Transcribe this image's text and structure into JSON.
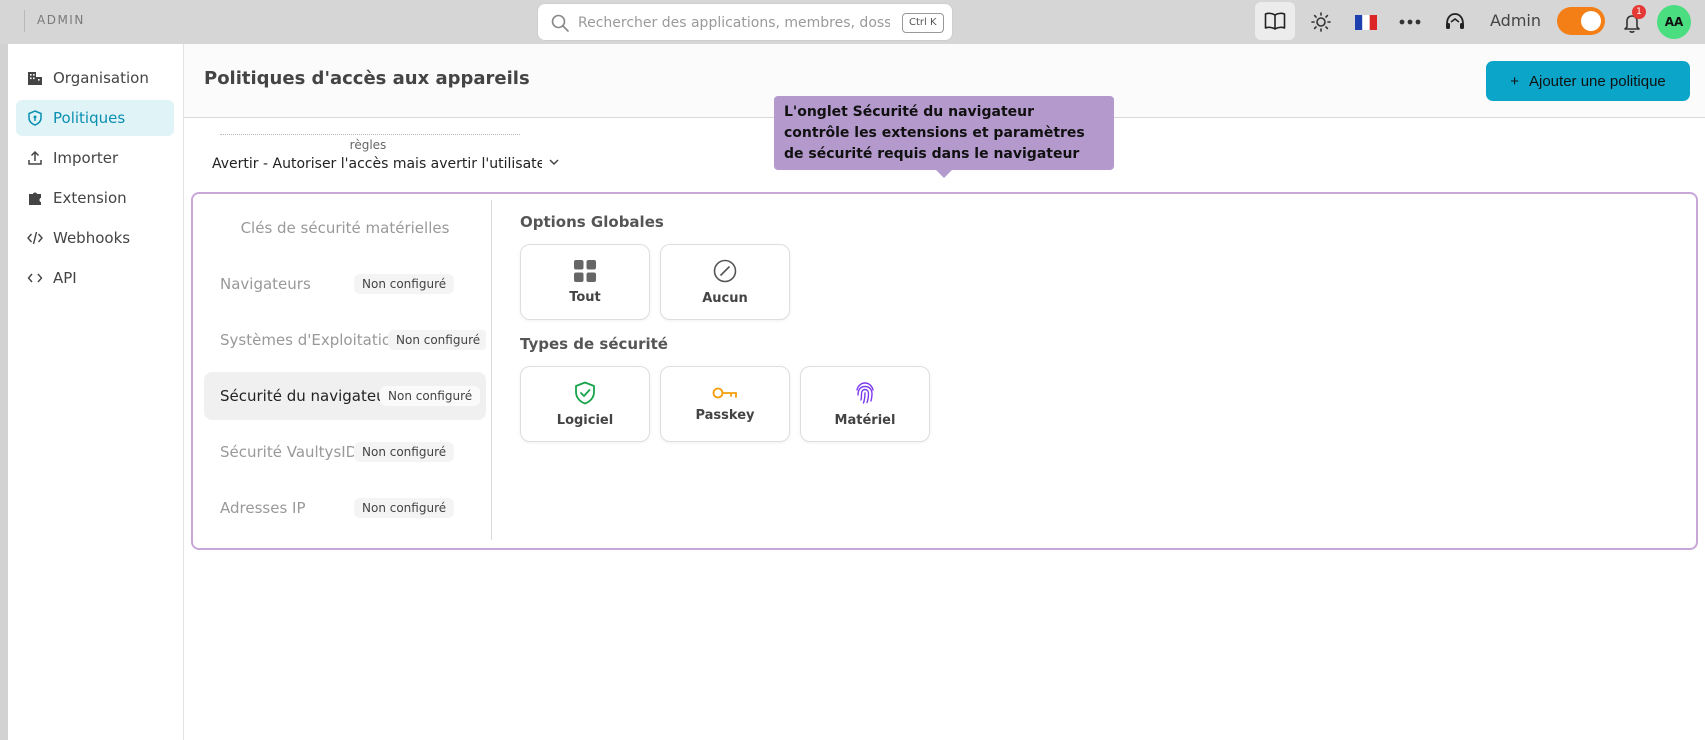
{
  "topbar": {
    "brand": "ADMIN",
    "search_placeholder": "Rechercher des applications, membres, dossiers",
    "search_shortcut": "Ctrl K",
    "user_label": "Admin",
    "notification_count": "1",
    "avatar_initials": "AA",
    "icons": [
      "book-icon",
      "sun-icon",
      "flag-fr-icon",
      "more-icon",
      "support-icon",
      "bell-icon"
    ]
  },
  "sidebar": {
    "items": [
      {
        "label": "Organisation",
        "icon": "building-icon",
        "active": false
      },
      {
        "label": "Politiques",
        "icon": "shield-icon",
        "active": true
      },
      {
        "label": "Importer",
        "icon": "upload-icon",
        "active": false
      },
      {
        "label": "Extension",
        "icon": "puzzle-icon",
        "active": false
      },
      {
        "label": "Webhooks",
        "icon": "code-slash-icon",
        "active": false
      },
      {
        "label": "API",
        "icon": "code-icon",
        "active": false
      }
    ]
  },
  "main": {
    "title": "Politiques d'accès aux appareils",
    "add_button": "Ajouter une politique",
    "rule_select": {
      "label": "règles",
      "value": "Avertir - Autoriser l'accès mais avertir l'utilisate..."
    },
    "tooltip": "L'onglet Sécurité du navigateur contrôle les extensions et paramètres de sécurité requis dans le navigateur",
    "tabs": [
      {
        "label": "Clés de sécurité matérielles",
        "status": ""
      },
      {
        "label": "Navigateurs",
        "status": "Non configuré"
      },
      {
        "label": "Systèmes d'Exploitation",
        "status": "Non configuré"
      },
      {
        "label": "Sécurité du navigateur",
        "status": "Non configuré",
        "active": true
      },
      {
        "label": "Sécurité VaultysID",
        "status": "Non configuré"
      },
      {
        "label": "Adresses IP",
        "status": "Non configuré"
      }
    ],
    "global_options": {
      "title": "Options Globales",
      "items": [
        {
          "label": "Tout",
          "icon": "grid-icon"
        },
        {
          "label": "Aucun",
          "icon": "forbidden-icon"
        }
      ]
    },
    "security_types": {
      "title": "Types de sécurité",
      "items": [
        {
          "label": "Logiciel",
          "icon": "shield-check-icon",
          "color": "#16a34a"
        },
        {
          "label": "Passkey",
          "icon": "key-icon",
          "color": "#f59e0b"
        },
        {
          "label": "Matériel",
          "icon": "fingerprint-icon",
          "color": "#7c3aed"
        }
      ]
    }
  },
  "colors": {
    "accent": "#0aa5c9",
    "toggle": "#f57f17",
    "tooltip": "#b49acc",
    "highlight_border": "#c8a7d8"
  }
}
